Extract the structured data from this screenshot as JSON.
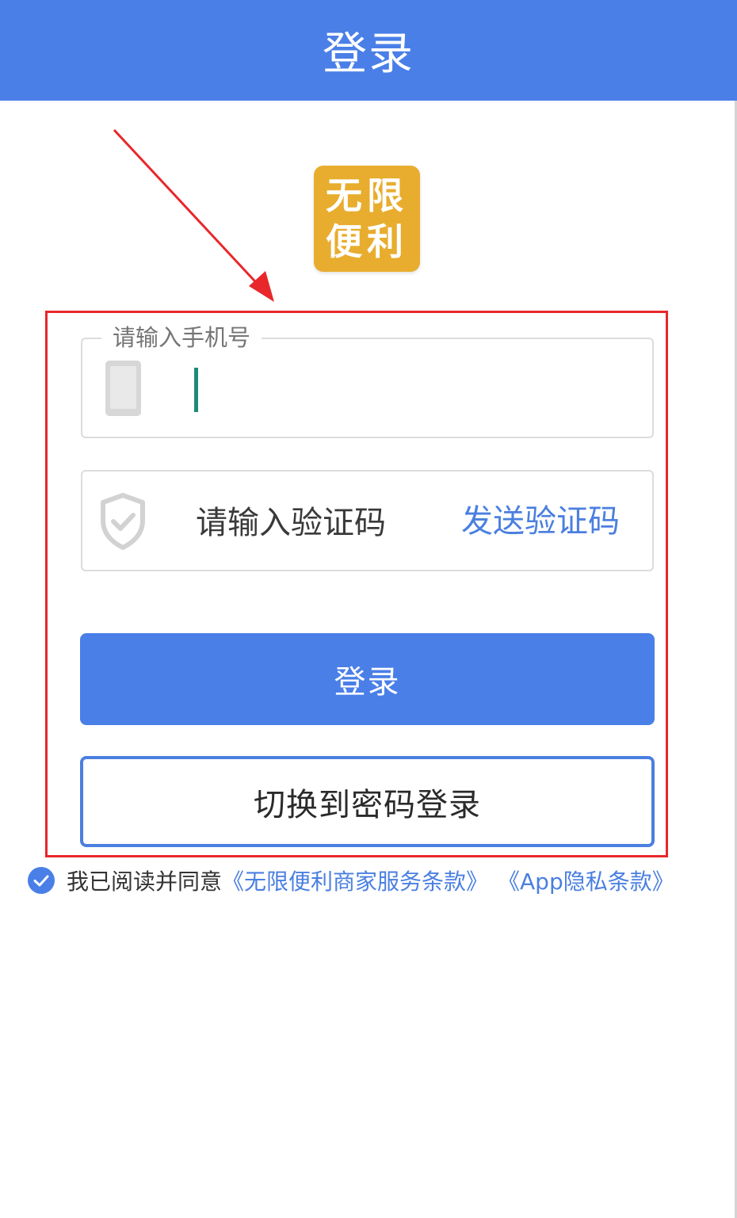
{
  "colors": {
    "primary": "#4a7fe8",
    "link": "#4a7fe0",
    "logo": "#e8ad2e",
    "annotation": "#e8272a"
  },
  "header": {
    "title": "登录"
  },
  "logo": {
    "line1": "无限",
    "line2": "便利"
  },
  "phone": {
    "placeholder": "请输入手机号",
    "icon": "phone-icon"
  },
  "code": {
    "placeholder": "请输入验证码",
    "send_label": "发送验证码",
    "icon": "shield-check-icon"
  },
  "login_button": {
    "label": "登录"
  },
  "switch_button": {
    "label": "切换到密码登录"
  },
  "agreement": {
    "checked": true,
    "prefix": "我已阅读并同意",
    "terms_link": "《无限便利商家服务条款》",
    "privacy_link": "《App隐私条款》"
  }
}
